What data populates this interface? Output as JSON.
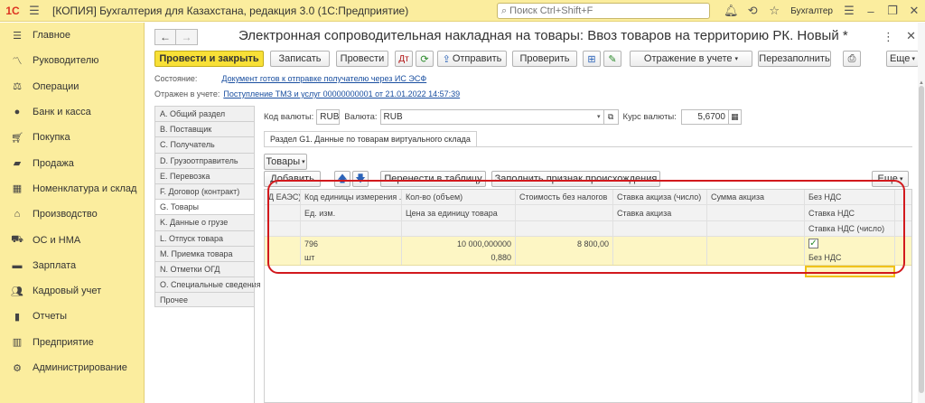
{
  "window": {
    "logo": "1С",
    "title": "[КОПИЯ] Бухгалтерия для Казахстана, редакция 3.0  (1С:Предприятие)",
    "search_placeholder": "Поиск Ctrl+Shift+F",
    "user": "Бухгалтер"
  },
  "sidebar": {
    "items": [
      {
        "label": "Главное",
        "icon": "menu-icon"
      },
      {
        "label": "Руководителю",
        "icon": "trend-icon"
      },
      {
        "label": "Операции",
        "icon": "operations-icon"
      },
      {
        "label": "Банк и касса",
        "icon": "coin-icon"
      },
      {
        "label": "Покупка",
        "icon": "cart-icon"
      },
      {
        "label": "Продажа",
        "icon": "bag-icon"
      },
      {
        "label": "Номенклатура и склад",
        "icon": "warehouse-icon"
      },
      {
        "label": "Производство",
        "icon": "factory-icon"
      },
      {
        "label": "ОС и НМА",
        "icon": "truck-icon"
      },
      {
        "label": "Зарплата",
        "icon": "wallet-icon"
      },
      {
        "label": "Кадровый учет",
        "icon": "people-icon"
      },
      {
        "label": "Отчеты",
        "icon": "chart-icon"
      },
      {
        "label": "Предприятие",
        "icon": "building-icon"
      },
      {
        "label": "Администрирование",
        "icon": "gear-icon"
      }
    ]
  },
  "document": {
    "title": "Электронная сопроводительная накладная на товары: Ввоз товаров на территорию РК. Новый *"
  },
  "toolbar": {
    "post_close": "Провести и закрыть",
    "save": "Записать",
    "post": "Провести",
    "send": "Отправить",
    "check": "Проверить",
    "accounting": "Отражение в учете",
    "refill": "Перезаполнить",
    "more": "Еще"
  },
  "status": {
    "state_label": "Состояние:",
    "state_value": "Документ готов к отправке получателю через ИС ЭСФ",
    "reflected_label": "Отражен в учете:",
    "reflected_value": "Поступление ТМЗ и услуг 00000000001 от 21.01.2022 14:57:39"
  },
  "tabs": [
    "A. Общий раздел",
    "B. Поставщик",
    "C. Получатель",
    "D. Грузоотправитель",
    "E. Перевозка",
    "F. Договор (контракт)",
    "G. Товары",
    "K. Данные о грузе",
    "L. Отпуск товара",
    "M. Приемка товара",
    "N. Отметки ОГД",
    "O. Специальные сведения",
    "Прочее"
  ],
  "currency": {
    "code_label": "Код валюты:",
    "code_value": "RUB",
    "currency_label": "Валюта:",
    "currency_value": "RUB",
    "rate_label": "Курс валюты:",
    "rate_value": "5,6700"
  },
  "section": {
    "subtab": "Раздел G1. Данные по товарам виртуального склада",
    "goods_button": "Товары",
    "add_button": "Добавить",
    "transfer_button": "Перенести в таблицу",
    "fill_origin_button": "Заполнить признак происхождения",
    "more_button": "Еще"
  },
  "table": {
    "header1": [
      "Д ЕАЭС)",
      "Код единицы измерения ...",
      "Кол-во (объем)",
      "Стоимость без налогов",
      "Ставка акциза (число)",
      "Сумма акциза",
      "Без НДС"
    ],
    "header2": [
      "",
      "Ед. изм.",
      "Цена за единицу товара",
      "",
      "Ставка акциза",
      "",
      "Ставка НДС"
    ],
    "header3": [
      "",
      "",
      "",
      "",
      "",
      "",
      "Ставка НДС (число)"
    ],
    "row1": [
      "",
      "796",
      "10 000,000000",
      "8 800,00",
      "",
      "",
      ""
    ],
    "row2": [
      "",
      "шт",
      "0,880",
      "",
      "",
      "",
      "Без НДС"
    ],
    "checked": true
  }
}
